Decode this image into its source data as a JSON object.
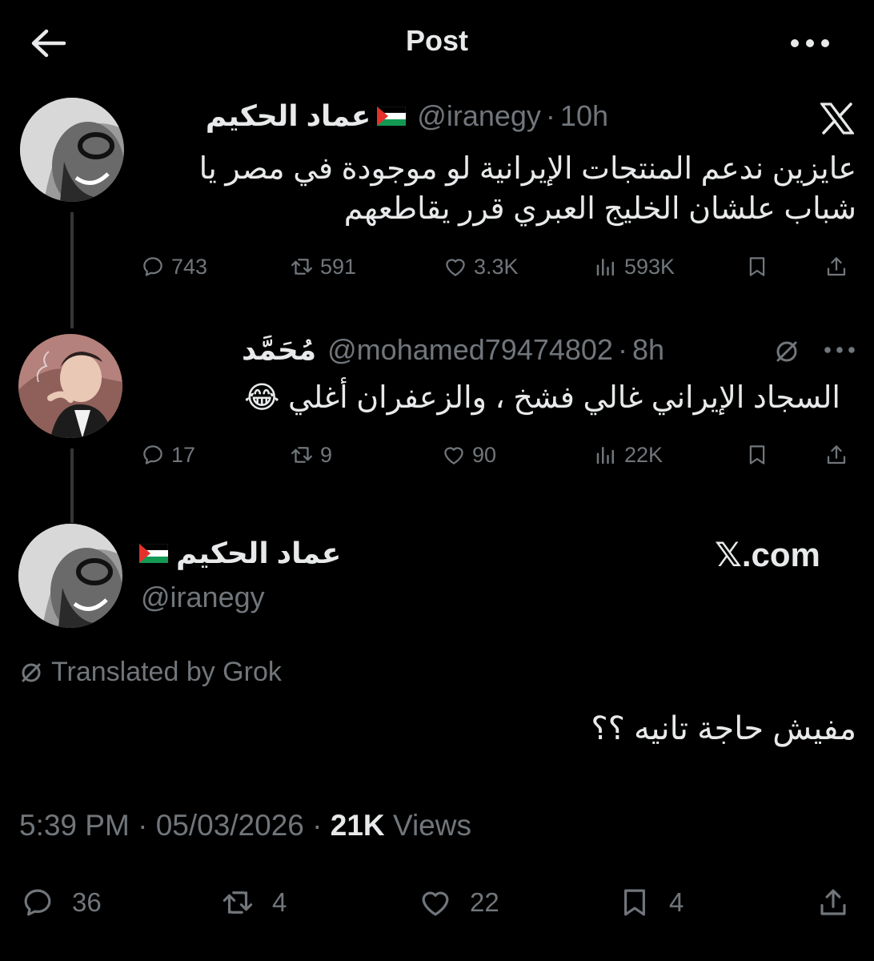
{
  "header": {
    "title": "Post"
  },
  "tweet1": {
    "name": "عماد الحكيم",
    "handle": "@iranegy",
    "separator": "·",
    "time": "10h",
    "text_line1": "عايزين ندعم المنتجات الإيرانية لو موجودة في مصر يا",
    "text_line2": "شباب علشان الخليج العبري قرر يقاطعهم",
    "replies": "743",
    "reposts": "591",
    "likes": "3.3K",
    "views": "593K"
  },
  "tweet2": {
    "name": "مُحَمَّد",
    "handle": "@mohamed79474802",
    "separator": "·",
    "time": "8h",
    "text": "السجاد الإيراني غالي فشخ ، والزعفران أغلي 😂",
    "replies": "17",
    "reposts": "9",
    "likes": "90",
    "views": "22K"
  },
  "main": {
    "name": "عماد الحكيم",
    "handle": "@iranegy",
    "source": "𝕏.com",
    "translated_label": "Translated by Grok",
    "text": "مفيش حاجة تانيه ؟؟",
    "time": "5:39 PM",
    "separator": "·",
    "date": "05/03/2026",
    "views_count": "21K",
    "views_label": "Views",
    "replies": "36",
    "reposts": "4",
    "likes": "22",
    "bookmarks": "4"
  },
  "colors": {
    "background": "#000000",
    "text": "#e7e9ea",
    "muted": "#71767b",
    "thread_line": "#333639"
  },
  "icons": [
    "back-arrow-icon",
    "more-icon",
    "x-logo-icon",
    "palestine-flag-icon",
    "grok-icon",
    "reply-icon",
    "repost-icon",
    "like-icon",
    "views-icon",
    "bookmark-icon",
    "share-icon"
  ]
}
